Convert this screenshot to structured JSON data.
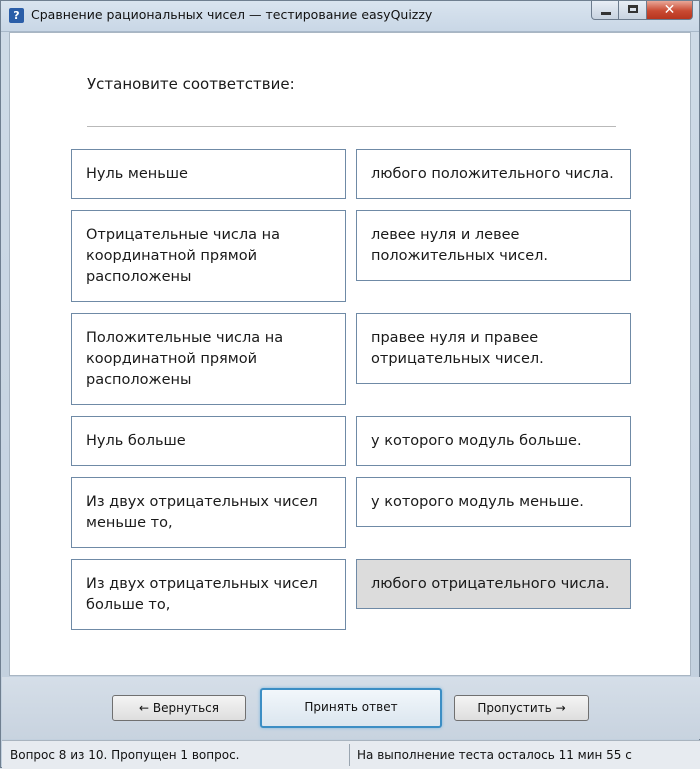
{
  "window": {
    "title": "Сравнение рациональных чисел — тестирование easyQuizzy",
    "icon": "question-mark-icon",
    "controls": {
      "minimize": "minimize-icon",
      "maximize": "maximize-icon",
      "close": "✕"
    }
  },
  "question": {
    "prompt": "Установите соответствие:"
  },
  "left_items": [
    "Нуль меньше",
    "Отрицательные числа на координатной прямой расположены",
    "Положительные числа на координатной прямой расположены",
    "Нуль больше",
    "Из двух отрицательных чисел меньше то,",
    "Из двух отрицательных чисел больше то,"
  ],
  "right_items": [
    "любого положительного числа.",
    "левее нуля и левее положительных чисел.",
    "правее нуля и правее отрицательных чисел.",
    "у которого модуль больше.",
    "у которого модуль меньше.",
    "любого отрицательного числа."
  ],
  "selected_right_index": 5,
  "buttons": {
    "back": "← Вернуться",
    "accept": "Принять ответ",
    "skip": "Пропустить →"
  },
  "status": {
    "progress": "Вопрос 8 из 10. Пропущен 1 вопрос.",
    "time_left": "На выполнение теста осталось 11 мин 55 с"
  },
  "colors": {
    "selected_cell": "#dcdcdc",
    "cell_border": "#6f8aa6",
    "close_button": "#c94a32",
    "primary_button_border": "#3c8ec4"
  }
}
